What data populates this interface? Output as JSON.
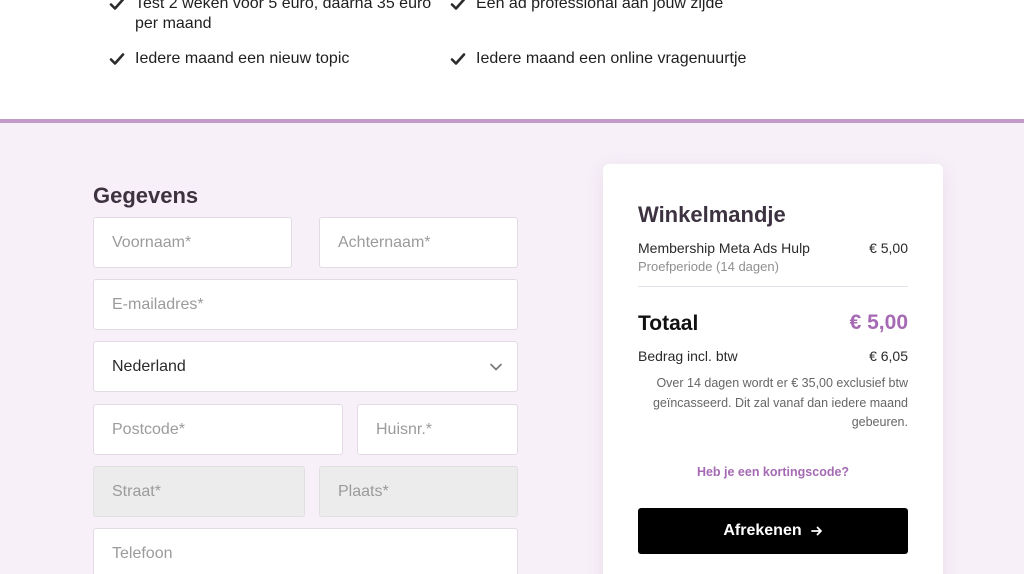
{
  "benefits": [
    {
      "text": "Test 2 weken voor 5 euro, daarna 35 euro per maand"
    },
    {
      "text": "Een ad professional aan jouw zijde"
    },
    {
      "text": "Iedere maand een nieuw topic"
    },
    {
      "text": "Iedere maand een online vragenuurtje"
    }
  ],
  "form": {
    "title": "Gegevens",
    "voornaam_placeholder": "Voornaam*",
    "achternaam_placeholder": "Achternaam*",
    "email_placeholder": "E-mailadres*",
    "country_value": "Nederland",
    "postcode_placeholder": "Postcode*",
    "huisnr_placeholder": "Huisnr.*",
    "straat_placeholder": "Straat*",
    "plaats_placeholder": "Plaats*",
    "telefoon_placeholder": "Telefoon"
  },
  "cart": {
    "title": "Winkelmandje",
    "item_name": "Membership Meta Ads Hulp",
    "item_price": "€ 5,00",
    "item_sub": "Proefperiode (14 dagen)",
    "total_label": "Totaal",
    "total_value": "€ 5,00",
    "btw_label": "Bedrag incl. btw",
    "btw_value": "€ 6,05",
    "note": "Over 14 dagen wordt er € 35,00 exclusief btw geïncasseerd. Dit zal vanaf dan iedere maand gebeuren.",
    "discount_link": "Heb je een kortingscode?",
    "checkout_label": "Afrekenen"
  },
  "colors": {
    "accent": "#a56ab3",
    "divider": "#c39ac9",
    "section_bg": "#f7f0f8",
    "button_bg": "#000000"
  },
  "icons": {
    "benefit": "check-icon",
    "select": "chevron-down-icon",
    "checkout": "arrow-right-icon"
  }
}
